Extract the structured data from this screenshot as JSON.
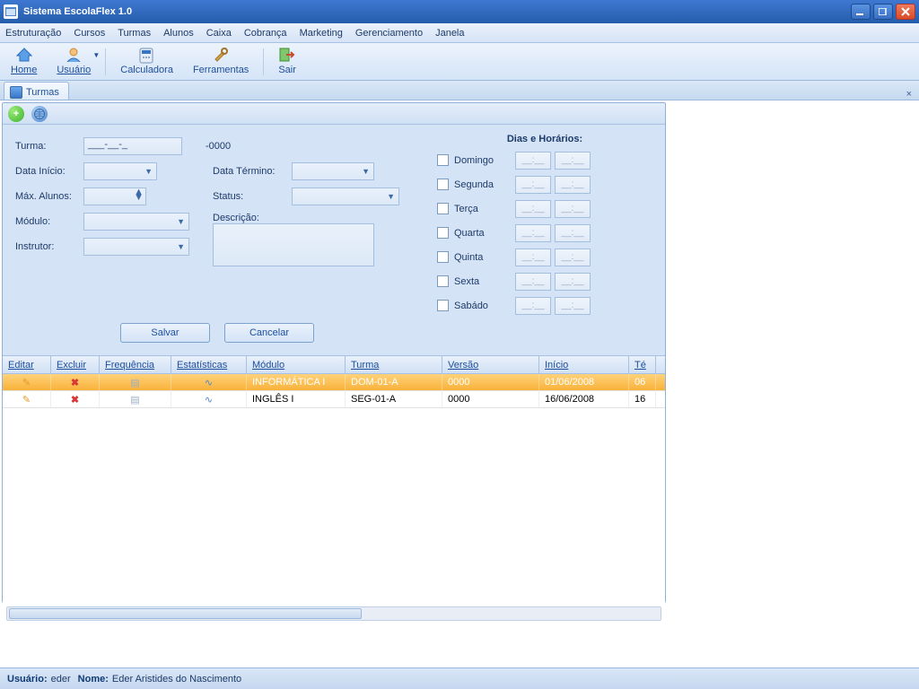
{
  "window": {
    "title": "Sistema EscolaFlex 1.0"
  },
  "menu": {
    "items": [
      "Estruturação",
      "Cursos",
      "Turmas",
      "Alunos",
      "Caixa",
      "Cobrança",
      "Marketing",
      "Gerenciamento",
      "Janela"
    ]
  },
  "toolbar": {
    "home": "Home",
    "usuario": "Usuário",
    "calculadora": "Calculadora",
    "ferramentas": "Ferramentas",
    "sair": "Sair"
  },
  "tab": {
    "label": "Turmas"
  },
  "form": {
    "turma_label": "Turma:",
    "turma_value": "___-__-_",
    "turma_suffix": "-0000",
    "data_inicio_label": "Data Início:",
    "max_alunos_label": "Máx. Alunos:",
    "modulo_label": "Módulo:",
    "instrutor_label": "Instrutor:",
    "data_termino_label": "Data Término:",
    "status_label": "Status:",
    "descricao_label": "Descrição:",
    "section_title": "Dias e Horários:",
    "days": [
      "Domingo",
      "Segunda",
      "Terça",
      "Quarta",
      "Quinta",
      "Sexta",
      "Sabádo"
    ],
    "time_placeholder": "__:__",
    "salvar": "Salvar",
    "cancelar": "Cancelar"
  },
  "grid": {
    "headers": [
      "Editar",
      "Excluir",
      "Frequência",
      "Estatísticas",
      "Módulo",
      "Turma",
      "Versão",
      "Início",
      "Té"
    ],
    "rows": [
      {
        "modulo": "INFORMÁTICA I",
        "turma": "DOM-01-A",
        "versao": "0000",
        "inicio": "01/06/2008",
        "te": "06"
      },
      {
        "modulo": "INGLÊS I",
        "turma": "SEG-01-A",
        "versao": "0000",
        "inicio": "16/06/2008",
        "te": "16"
      }
    ]
  },
  "status": {
    "usuario_label": "Usuário:",
    "usuario_value": "eder",
    "nome_label": "Nome:",
    "nome_value": "Eder Aristides do Nascimento"
  }
}
